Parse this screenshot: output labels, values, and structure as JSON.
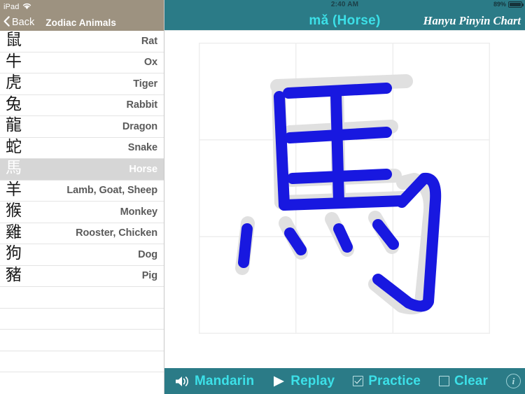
{
  "statusbar": {
    "device_label": "iPad",
    "wifi_icon": "wifi-icon",
    "time": "2:40 AM",
    "battery_percent": "89%",
    "battery_level": 89
  },
  "sidebar": {
    "back_label": "Back",
    "back_icon": "chevron-left-icon",
    "title": "Zodiac Animals",
    "header_color": "#9d9280",
    "selected_index": 6,
    "items": [
      {
        "han": "鼠",
        "english": "Rat"
      },
      {
        "han": "牛",
        "english": "Ox"
      },
      {
        "han": "虎",
        "english": "Tiger"
      },
      {
        "han": "兔",
        "english": "Rabbit"
      },
      {
        "han": "龍",
        "english": "Dragon"
      },
      {
        "han": "蛇",
        "english": "Snake"
      },
      {
        "han": "馬",
        "english": "Horse"
      },
      {
        "han": "羊",
        "english": "Lamb, Goat, Sheep"
      },
      {
        "han": "猴",
        "english": "Monkey"
      },
      {
        "han": "雞",
        "english": "Rooster, Chicken"
      },
      {
        "han": "狗",
        "english": "Dog"
      },
      {
        "han": "豬",
        "english": "Pig"
      }
    ],
    "empty_row_count": 4
  },
  "main": {
    "title": "mǎ  (Horse)",
    "app_title": "Hanyu Pinyin Chart",
    "nav_color": "#2b7b87",
    "title_color": "#3ce0e8"
  },
  "canvas": {
    "character": "馬",
    "grid_rows": 3,
    "grid_cols": 3,
    "grid_line_color": "#eeeeee",
    "guide_stroke_color": "#e0e0e0",
    "user_stroke_color": "#1818e0",
    "stroke_count": 10
  },
  "toolbar": {
    "background": "#2b7b87",
    "items": [
      {
        "label": "Mandarin",
        "icon": "speaker-icon",
        "type": "button"
      },
      {
        "label": "Replay",
        "icon": "play-icon",
        "type": "button"
      },
      {
        "label": "Practice",
        "icon": "checkbox-icon",
        "type": "checkbox",
        "checked": true
      },
      {
        "label": "Clear",
        "icon": "checkbox-icon",
        "type": "checkbox",
        "checked": false
      }
    ],
    "info_label": "i",
    "info_icon": "info-icon"
  }
}
